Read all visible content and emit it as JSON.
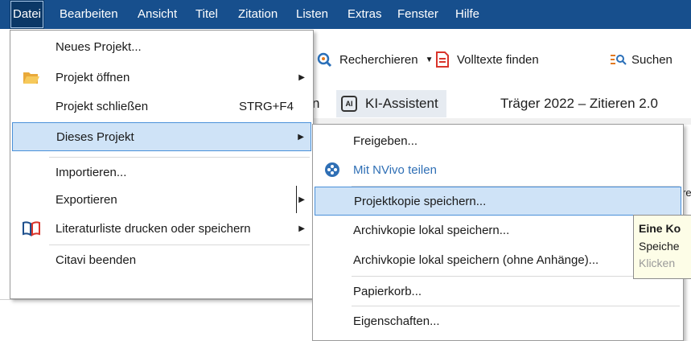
{
  "menubar": {
    "items": [
      "Datei",
      "Bearbeiten",
      "Ansicht",
      "Titel",
      "Zitation",
      "Listen",
      "Extras",
      "Fenster",
      "Hilfe"
    ]
  },
  "toolbar": {
    "recherchieren": "Recherchieren",
    "volltexte": "Volltexte finden",
    "suchen": "Suchen",
    "ki_assistent": "KI-Assistent",
    "doc_title": "Träger 2022 – Zitieren 2.0",
    "ki_icon_text": "AI",
    "partial_letter": "n"
  },
  "file_menu": {
    "items": [
      {
        "label": "Neues Projekt..."
      },
      {
        "label": "Projekt öffnen",
        "icon": "folder-open-icon",
        "submenu": true
      },
      {
        "label": "Projekt schließen",
        "shortcut": "STRG+F4"
      },
      {
        "label": "Dieses Projekt",
        "submenu": true,
        "highlighted": true
      },
      {
        "label": "Importieren..."
      },
      {
        "label": "Exportieren",
        "submenu": true
      },
      {
        "label": "Literaturliste drucken oder speichern",
        "icon": "book-print-icon",
        "submenu": true
      },
      {
        "label": "Citavi beenden"
      }
    ]
  },
  "project_submenu": {
    "items": [
      {
        "label": "Freigeben..."
      },
      {
        "label": "Mit NVivo teilen",
        "icon": "nvivo-icon",
        "color": "#2f6fb5"
      },
      {
        "label": "Projektkopie speichern...",
        "highlighted": true
      },
      {
        "label": "Archivkopie lokal speichern..."
      },
      {
        "label": "Archivkopie lokal speichern (ohne Anhänge)..."
      },
      {
        "label": "Papierkorb..."
      },
      {
        "label": "Eigenschaften..."
      }
    ]
  },
  "tooltip": {
    "title": "Eine Ko",
    "line1": "Speiche",
    "line2": "Klicken"
  },
  "partial_text": {
    "a": "re",
    "b": "ie"
  },
  "colors": {
    "menubar_bg": "#174f8d",
    "highlight_bg": "#cfe3f7",
    "highlight_border": "#4a90d9",
    "nvivo_blue": "#2f6fb5"
  }
}
